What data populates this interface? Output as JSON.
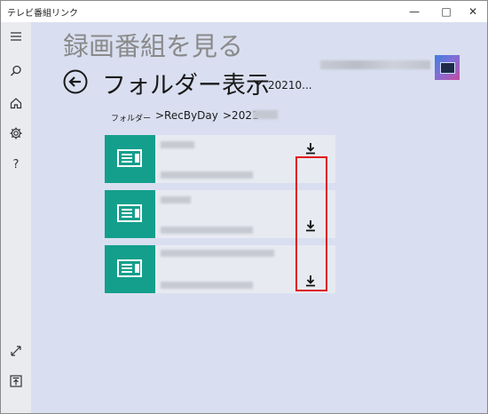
{
  "window": {
    "title": "テレビ番組リンク"
  },
  "header": {
    "app_title": "録画番組を見る",
    "folder_title": "フォルダー表示",
    "folder_subtitle": "20210..."
  },
  "breadcrumb": [
    "フォルダー",
    ">RecByDay",
    ">2021"
  ],
  "sidebar": {
    "items": [
      {
        "icon": "hamburger-menu-icon"
      },
      {
        "icon": "search-icon"
      },
      {
        "icon": "home-icon"
      },
      {
        "icon": "gear-icon"
      },
      {
        "icon": "help-icon"
      },
      {
        "icon": "expand-icon"
      },
      {
        "icon": "upload-icon"
      }
    ]
  },
  "recordings": [
    {
      "action": "download"
    },
    {
      "action": "download"
    },
    {
      "action": "download"
    }
  ],
  "colors": {
    "accent": "#149f8c",
    "highlight": "#e0161e",
    "background": "#d9dff0"
  }
}
